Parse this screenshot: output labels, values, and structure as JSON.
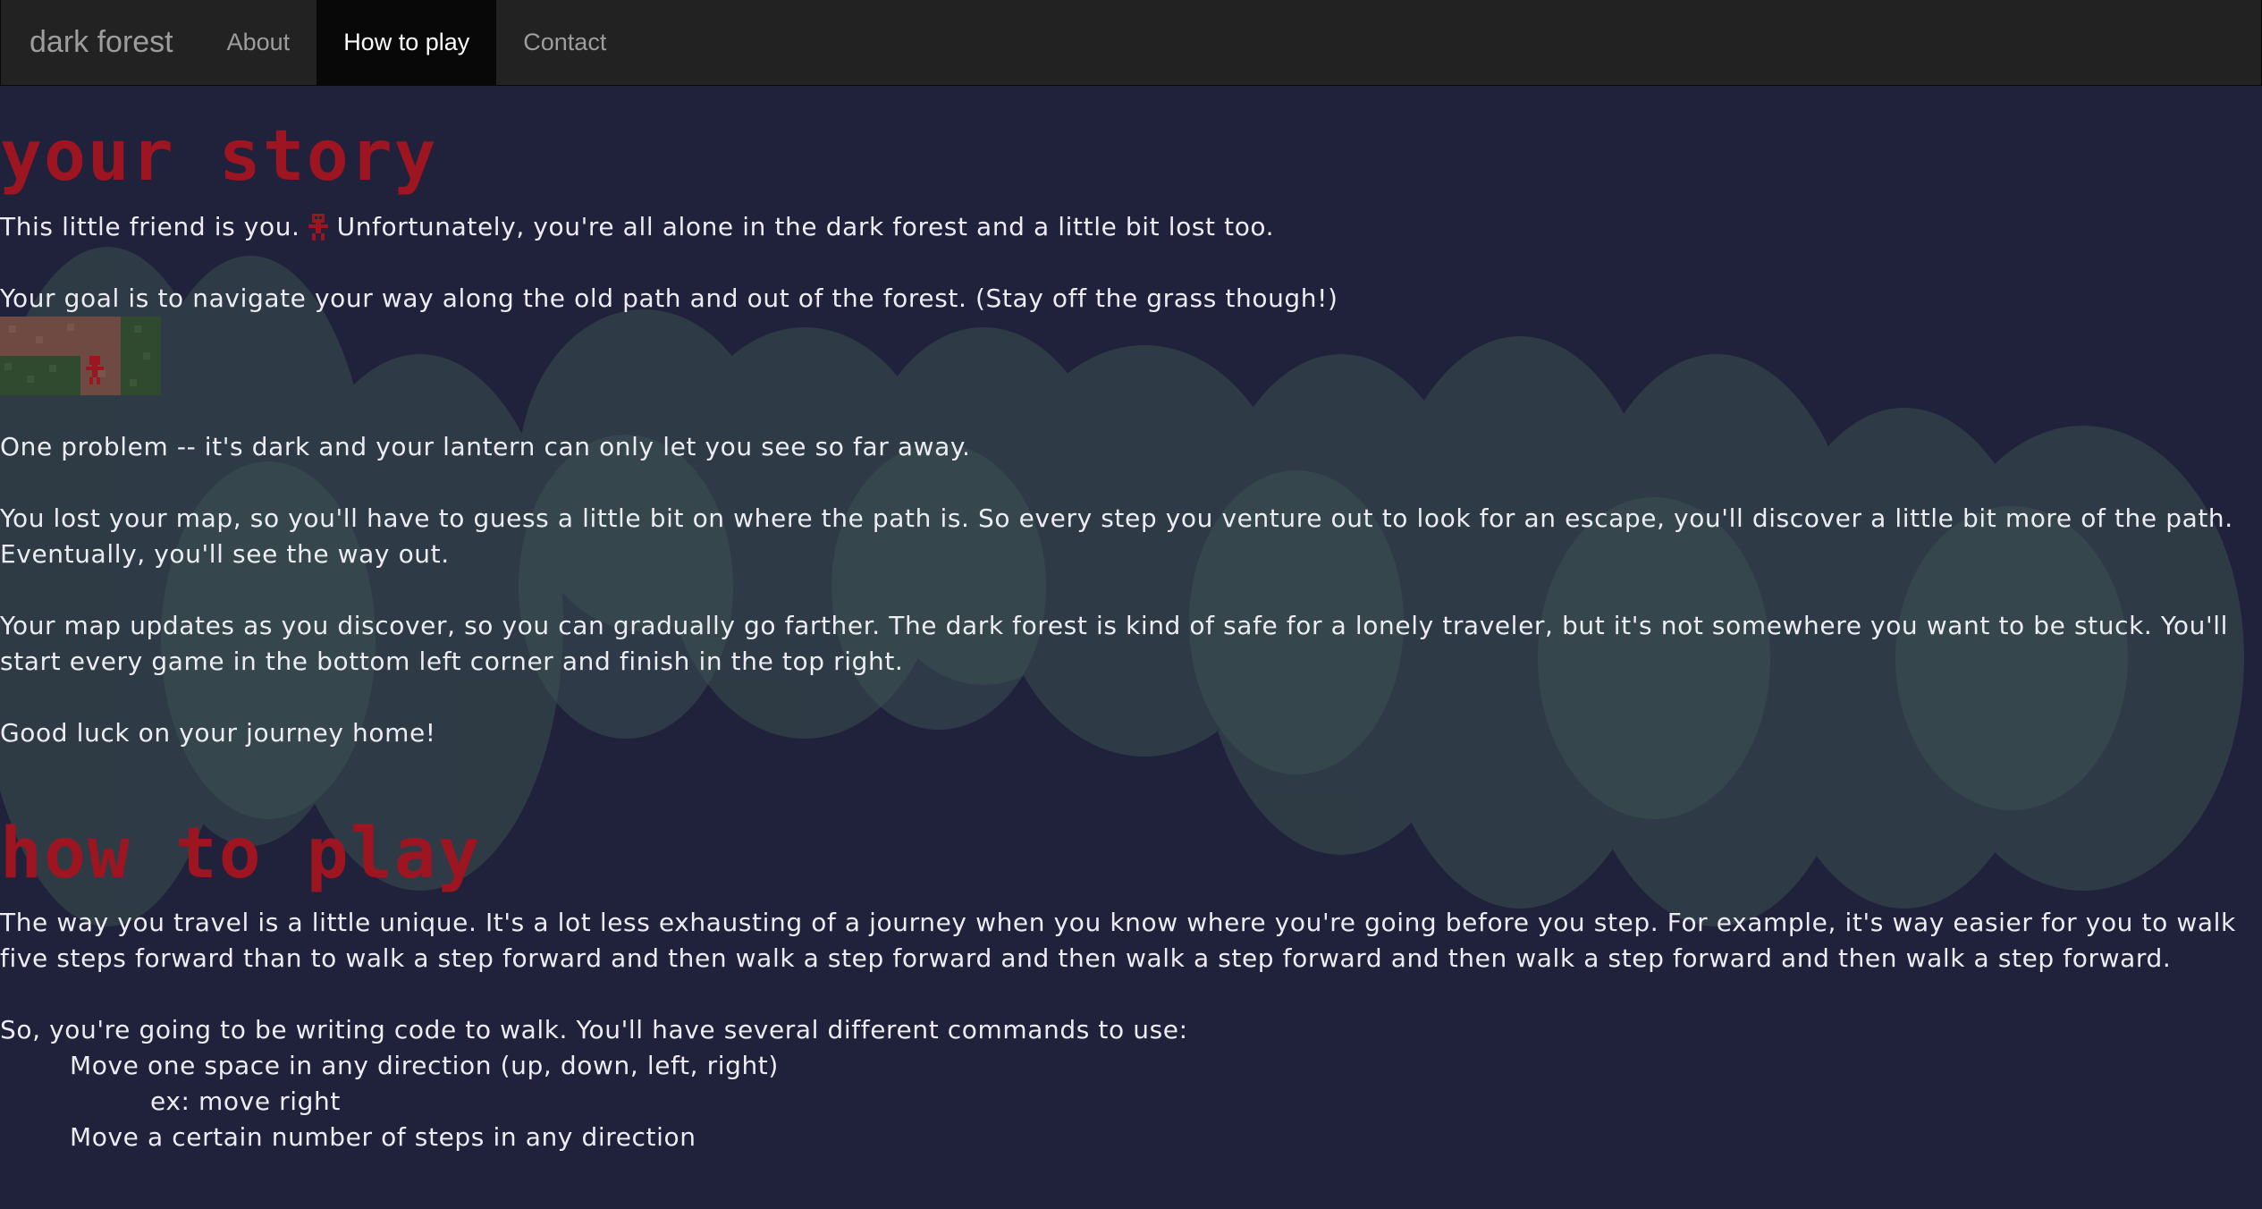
{
  "nav": {
    "brand": "dark forest",
    "items": [
      {
        "label": "About",
        "active": false
      },
      {
        "label": "How to play",
        "active": true
      },
      {
        "label": "Contact",
        "active": false
      }
    ]
  },
  "story": {
    "heading": "your story",
    "p1_before": "This little friend is you.",
    "p1_after": "Unfortunately, you're all alone in the dark forest and a little bit lost too.",
    "p2": "Your goal is to navigate your way along the old path and out of the forest. (Stay off the grass though!)",
    "p3": "One problem -- it's dark and your lantern can only let you see so far away.",
    "p4": "You lost your map, so you'll have to guess a little bit on where the path is. So every step you venture out to look for an escape, you'll discover a little bit more of the path. Eventually, you'll see the way out.",
    "p5": "Your map updates as you discover, so you can gradually go farther. The dark forest is kind of safe for a lonely traveler, but it's not somewhere you want to be stuck. You'll start every game in the bottom left corner and finish in the top right.",
    "p6": "Good luck on your journey home!"
  },
  "howto": {
    "heading": "how to play",
    "p1": "The way you travel is a little unique. It's a lot less exhausting of a journey when you know where you're going before you step. For example, it's way easier for you to walk five steps forward than to walk a step forward and then walk a step forward and then walk a step forward and then walk a step forward and then walk a step forward.",
    "p2": "So, you're going to be writing code to walk. You'll have several different commands to use:",
    "cmd1": "Move one space in any direction (up, down, left, right)",
    "cmd1_ex": "ex: move right",
    "cmd2": "Move a certain number of steps in any direction"
  },
  "colors": {
    "background": "#20213a",
    "heading": "#9c1520",
    "forest": "#33444a",
    "path": "#6e4a42",
    "grass": "#2f4a2f"
  }
}
